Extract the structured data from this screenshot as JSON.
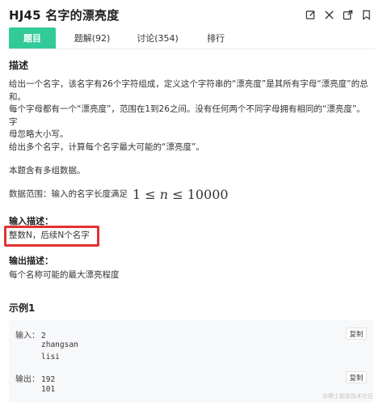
{
  "header": {
    "title": "HJ45  名字的漂亮度",
    "icons": [
      "edit-icon",
      "close-icon",
      "share-icon",
      "bookmark-icon"
    ]
  },
  "tabs": [
    {
      "label": "题目",
      "active": true
    },
    {
      "label": "题解(92)",
      "active": false
    },
    {
      "label": "讨论(354)",
      "active": false
    },
    {
      "label": "排行",
      "active": false
    }
  ],
  "description": {
    "heading": "描述",
    "line1": "给出一个名字，该名字有26个字符组成，定义这个字符串的“漂亮度”是其所有字母“漂亮度”的总",
    "line2": "和。",
    "line3": "每个字母都有一个“漂亮度”，范围在1到26之间。没有任何两个不同字母拥有相同的“漂亮度”。字",
    "line4": "母忽略大小写。",
    "line5": "给出多个名字，计算每个名字最大可能的“漂亮度”。",
    "multi": "本题含有多组数据。",
    "range_prefix": "数据范围：输入的名字长度满足",
    "range_formula_1": "1",
    "range_formula_op1": "≤",
    "range_formula_n": "n",
    "range_formula_op2": "≤",
    "range_formula_max": "10000"
  },
  "input_desc": {
    "heading": "输入描述：",
    "text": "整数N，后续N个名字"
  },
  "output_desc": {
    "heading": "输出描述：",
    "text": "每个名称可能的最大漂亮程度"
  },
  "example": {
    "heading": "示例1",
    "input_label": "输入：",
    "input_lines": [
      "2",
      "zhangsan",
      "lisi"
    ],
    "output_label": "输出：",
    "output_lines": [
      "192",
      "101"
    ],
    "copy_label": "复制"
  },
  "watermark": "@稀土掘金技术社区",
  "colors": {
    "accent": "#32ca99",
    "highlight": "#e53030"
  }
}
